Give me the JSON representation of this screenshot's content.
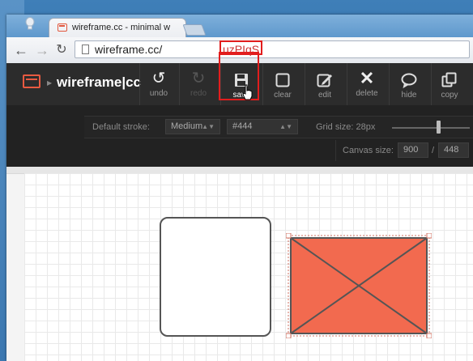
{
  "browser": {
    "tab_title": "wireframe.cc - minimal w",
    "url_base": "wireframe.cc/",
    "url_hash": "uzPIqS"
  },
  "app": {
    "name": "wireframe|cc",
    "tools": [
      {
        "label": "undo",
        "icon": "undo-icon"
      },
      {
        "label": "redo",
        "icon": "redo-icon"
      },
      {
        "label": "save",
        "icon": "save-icon"
      },
      {
        "label": "clear",
        "icon": "clear-icon"
      },
      {
        "label": "edit",
        "icon": "edit-icon"
      },
      {
        "label": "delete",
        "icon": "delete-icon"
      },
      {
        "label": "hide",
        "icon": "hide-icon"
      },
      {
        "label": "copy",
        "icon": "copy-icon"
      }
    ],
    "settings": {
      "stroke_label": "Default stroke:",
      "stroke_value": "Medium",
      "color_value": "#444",
      "grid_label": "Grid size: 28px",
      "grid_value": 0.6,
      "canvas_label": "Canvas size:",
      "canvas_width": "900",
      "canvas_sep": "/",
      "canvas_height": "448"
    }
  },
  "colors": {
    "accent": "#e85a41",
    "placeholder_fill": "#f26a4f",
    "highlight": "#e21d1d"
  }
}
